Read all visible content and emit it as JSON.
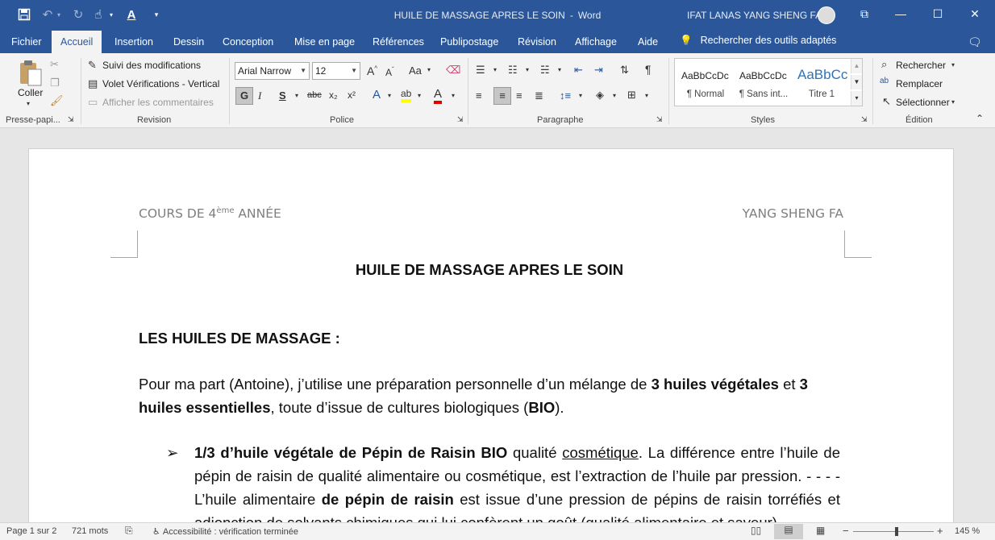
{
  "window": {
    "doc_title": "HUILE DE MASSAGE APRES LE SOIN",
    "separator": "-",
    "app_name": "Word",
    "user_name": "IFAT LANAS YANG SHENG FA"
  },
  "tabs": [
    "Fichier",
    "Accueil",
    "Insertion",
    "Dessin",
    "Conception",
    "Mise en page",
    "Références",
    "Publipostage",
    "Révision",
    "Affichage",
    "Aide"
  ],
  "tellme": "Rechercher des outils adaptés",
  "ribbon": {
    "clipboard": {
      "paste_label": "Coller",
      "group": "Presse-papi..."
    },
    "revision": {
      "track": "Suivi des modifications",
      "pane": "Volet Vérifications - Vertical",
      "comments": "Afficher les commentaires",
      "group": "Revision"
    },
    "font": {
      "name": "Arial Narrow",
      "size": "12",
      "bold": "G",
      "italic": "I",
      "underline": "S",
      "strike": "abc",
      "subscript": "x₂",
      "superscript": "x²",
      "case": "Aa",
      "group": "Police"
    },
    "paragraph": {
      "group": "Paragraphe",
      "pilcrow": "¶"
    },
    "styles": {
      "items": [
        {
          "preview": "AaBbCcDc",
          "name": "¶ Normal"
        },
        {
          "preview": "AaBbCcDc",
          "name": "¶ Sans int..."
        },
        {
          "preview": "AaBbCc",
          "name": "Titre 1"
        }
      ],
      "group": "Styles"
    },
    "edit": {
      "find": "Rechercher",
      "replace": "Remplacer",
      "select": "Sélectionner",
      "group": "Édition"
    }
  },
  "document": {
    "header_left_a": "COURS DE 4",
    "header_left_sup": "ème",
    "header_left_b": " ANNÉE",
    "header_right": "YANG SHENG FA",
    "title": "HUILE DE MASSAGE APRES LE SOIN",
    "section": "LES HUILES DE MASSAGE :",
    "p1": {
      "a": "Pour ma part (Antoine), j’utilise une préparation personnelle d’un mélange de ",
      "b": "3 huiles végétales",
      "c": " et ",
      "d": "3 huiles essentielles",
      "e": ", toute d’issue de cultures biologiques (",
      "f": "BIO",
      "g": ")."
    },
    "bullet_glyph": "➢",
    "b1": {
      "a": "1/3 d’huile végétale de Pépin de Raisin BIO",
      "b": " qualité ",
      "c": "cosmétique",
      "d": ". La différence entre l’huile de pépin de raisin de qualité alimentaire ou cosmétique, est l’extraction de l’huile par pression. - - - - L’huile alimentaire ",
      "e": "de pépin de raisin",
      "f": " est issue d’une pression de pépins de raisin torréfiés et adjonction de solvants chimiques qui lui confèrent un goût (qualité alimentaire et saveur)."
    }
  },
  "status": {
    "page": "Page 1 sur 2",
    "words": "721 mots",
    "accessibility": "Accessibilité : vérification terminée",
    "zoom": "145 %"
  },
  "colors": {
    "brand": "#2b579a",
    "highlight": "#ffff00",
    "font_color": "#e00000"
  }
}
